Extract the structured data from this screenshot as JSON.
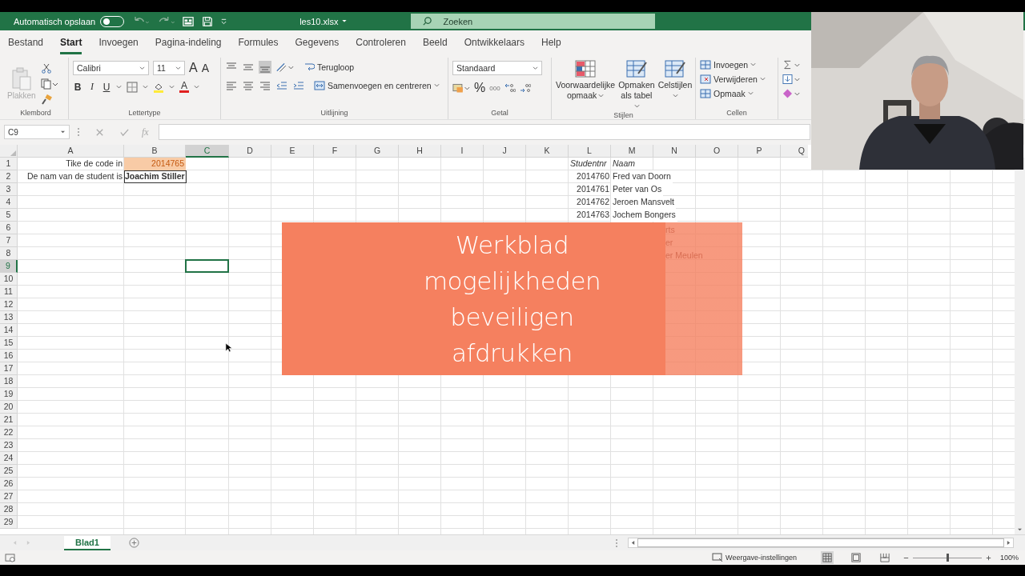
{
  "title_bar": {
    "autosave_label": "Automatisch opslaan",
    "autosave_on": false,
    "filename": "les10.xlsx",
    "search_placeholder": "Zoeken"
  },
  "menu_tabs": [
    {
      "label": "Bestand",
      "selected": false
    },
    {
      "label": "Start",
      "selected": true
    },
    {
      "label": "Invoegen",
      "selected": false
    },
    {
      "label": "Pagina-indeling",
      "selected": false
    },
    {
      "label": "Formules",
      "selected": false
    },
    {
      "label": "Gegevens",
      "selected": false
    },
    {
      "label": "Controleren",
      "selected": false
    },
    {
      "label": "Beeld",
      "selected": false
    },
    {
      "label": "Ontwikkelaars",
      "selected": false
    },
    {
      "label": "Help",
      "selected": false
    }
  ],
  "ribbon": {
    "clipboard": {
      "paste": "Plakken",
      "label": "Klembord"
    },
    "font": {
      "font": "Calibri",
      "size": "11",
      "grow": "A",
      "shrink": "A",
      "bold": "B",
      "italic": "I",
      "underline": "U",
      "font_color": "A",
      "label": "Lettertype"
    },
    "alignment": {
      "wrap": "Terugloop",
      "merge": "Samenvoegen en centreren",
      "label": "Uitlijning"
    },
    "number": {
      "format": "Standaard",
      "percent": "%",
      "thousands": "000",
      "label": "Getal"
    },
    "styles": {
      "buttons": [
        "Voorwaardelijke opmaak",
        "Opmaken als tabel",
        "Celstijlen"
      ],
      "label": "Stijlen"
    },
    "cells": {
      "buttons": [
        "Invoegen",
        "Verwijderen",
        "Opmaak"
      ],
      "label": "Cellen"
    }
  },
  "formula_bar": {
    "name_box": "C9",
    "fx": "fx"
  },
  "sheet": {
    "columns": [
      {
        "label": "A",
        "selected": false
      },
      {
        "label": "B",
        "selected": false
      },
      {
        "label": "C",
        "selected": true
      },
      {
        "label": "D",
        "selected": false
      },
      {
        "label": "E",
        "selected": false
      },
      {
        "label": "F",
        "selected": false
      },
      {
        "label": "G",
        "selected": false
      },
      {
        "label": "H",
        "selected": false
      },
      {
        "label": "I",
        "selected": false
      },
      {
        "label": "J",
        "selected": false
      },
      {
        "label": "K",
        "selected": false
      },
      {
        "label": "L",
        "selected": false
      },
      {
        "label": "M",
        "selected": false
      },
      {
        "label": "N",
        "selected": false
      },
      {
        "label": "O",
        "selected": false
      },
      {
        "label": "P",
        "selected": false
      },
      {
        "label": "Q",
        "selected": false
      }
    ],
    "rows": [
      {
        "label": "1",
        "selected": false,
        "cells": [
          {
            "text": "Tike de code in",
            "kind": "label"
          },
          {
            "text": "2014765",
            "kind": "input"
          },
          null,
          null,
          null,
          null,
          null,
          null,
          null,
          null,
          null,
          {
            "text": "Studentnr",
            "kind": "heading"
          },
          {
            "text": "Naam",
            "kind": "heading"
          }
        ]
      },
      {
        "label": "2",
        "selected": false,
        "cells": [
          {
            "text": "De nam van de student is",
            "kind": "label"
          },
          {
            "text": "Joachim Stiller",
            "kind": "result"
          },
          null,
          null,
          null,
          null,
          null,
          null,
          null,
          null,
          null,
          {
            "text": "2014760",
            "kind": "number"
          },
          {
            "text": "Fred van Doorn",
            "kind": "text"
          }
        ]
      },
      {
        "label": "3",
        "selected": false,
        "cells": [
          null,
          null,
          null,
          null,
          null,
          null,
          null,
          null,
          null,
          null,
          null,
          {
            "text": "2014761",
            "kind": "number"
          },
          {
            "text": "Peter van Os",
            "kind": "text"
          }
        ]
      },
      {
        "label": "4",
        "selected": false,
        "cells": [
          null,
          null,
          null,
          null,
          null,
          null,
          null,
          null,
          null,
          null,
          null,
          {
            "text": "2014762",
            "kind": "number"
          },
          {
            "text": "Jeroen Mansvelt",
            "kind": "text"
          }
        ]
      },
      {
        "label": "5",
        "selected": false,
        "cells": [
          null,
          null,
          null,
          null,
          null,
          null,
          null,
          null,
          null,
          null,
          null,
          {
            "text": "2014763",
            "kind": "number"
          },
          {
            "text": "Jochem Bongers",
            "kind": "text"
          }
        ]
      },
      {
        "label": "6",
        "selected": false
      },
      {
        "label": "7",
        "selected": false
      },
      {
        "label": "8",
        "selected": false
      },
      {
        "label": "9",
        "selected": true
      },
      {
        "label": "10",
        "selected": false
      },
      {
        "label": "11",
        "selected": false
      },
      {
        "label": "12",
        "selected": false
      },
      {
        "label": "13",
        "selected": false
      },
      {
        "label": "14",
        "selected": false
      },
      {
        "label": "15",
        "selected": false
      },
      {
        "label": "16",
        "selected": false
      },
      {
        "label": "17",
        "selected": false
      },
      {
        "label": "18",
        "selected": false
      },
      {
        "label": "19",
        "selected": false
      },
      {
        "label": "20",
        "selected": false
      },
      {
        "label": "21",
        "selected": false
      },
      {
        "label": "22",
        "selected": false
      },
      {
        "label": "23",
        "selected": false
      },
      {
        "label": "24",
        "selected": false
      },
      {
        "label": "25",
        "selected": false
      },
      {
        "label": "26",
        "selected": false
      },
      {
        "label": "27",
        "selected": false
      },
      {
        "label": "28",
        "selected": false
      },
      {
        "label": "29",
        "selected": false
      }
    ]
  },
  "overlay": {
    "lines": [
      "Werkblad",
      "mogelijkheden",
      "beveiligen",
      "afdrukken"
    ],
    "faded_texts": [
      "rts",
      "er",
      "er Meulen"
    ]
  },
  "sheet_tabs": [
    {
      "label": "Blad1",
      "selected": true
    }
  ],
  "status_bar": {
    "view_settings": "Weergave-instellingen",
    "zoom": "100%",
    "level": 0.5
  }
}
